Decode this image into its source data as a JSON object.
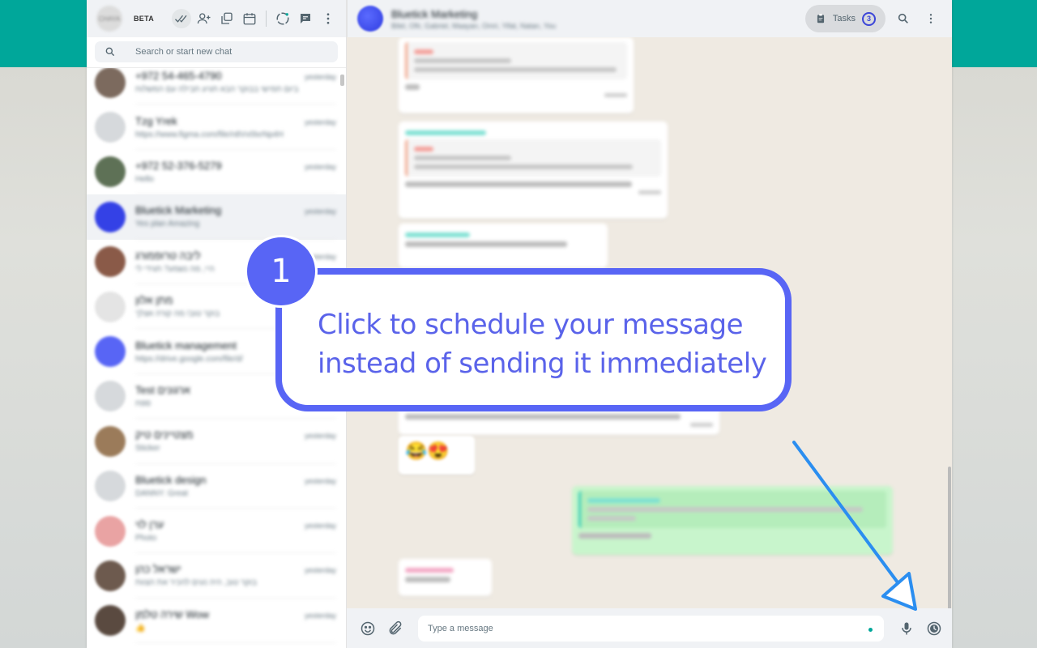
{
  "sidebar": {
    "avatar_text": "CHAYA",
    "beta_label": "BETA",
    "search_placeholder": "Search or start new chat",
    "chats": [
      {
        "name": "+972 54-465-4790",
        "time": "yesterday",
        "preview": "ביום חמישי בבוקר הבא תגיע חבילה עם המשלוח",
        "avatar": "#7c6a5e"
      },
      {
        "name": "Tzg Yrek",
        "time": "yesterday",
        "preview": "https://www.figma.com/file/n8Vv0lxrNp4H",
        "avatar": "#d6d9dc"
      },
      {
        "name": "+972 52-376-5279",
        "time": "yesterday",
        "preview": "Hello",
        "avatar": "#5e7156"
      },
      {
        "name": "Bluetick Marketing",
        "time": "yesterday",
        "preview": "Yes plan Amazing",
        "avatar": "#3441e6"
      },
      {
        "name": "ליבה טרופמורג",
        "time": "yesterday",
        "preview": "היי, מה נשמע? תגידי לי",
        "avatar": "#8a5a48"
      },
      {
        "name": "מתן אלון",
        "time": "yesterday",
        "preview": "בוקר טוב! מה קורה אצלך",
        "avatar": "#e4e4e4"
      },
      {
        "name": "Bluetick management",
        "time": "yesterday",
        "preview": "https://drive.google.com/file/d/",
        "avatar": "#5865f5"
      },
      {
        "name": "Test ארגונים",
        "time": "yesterday",
        "preview": "ספח",
        "avatar": "#d6d9dc"
      },
      {
        "name": "מצטיינים טיק",
        "time": "yesterday",
        "preview": "Sticker",
        "avatar": "#9b7b5a"
      },
      {
        "name": "Bluetick design",
        "time": "yesterday",
        "preview": "DANNY: Great",
        "avatar": "#d6d9dc"
      },
      {
        "name": "ערן לוי",
        "time": "yesterday",
        "preview": "Photo",
        "avatar": "#e9a3a3"
      },
      {
        "name": "ישראל כהן",
        "time": "yesterday",
        "preview": "בוקר טוב, היה נעים להכיר את הצוות",
        "avatar": "#6d5a4e"
      },
      {
        "name": "שירה טלמן Wow",
        "time": "yesterday",
        "preview": "👍",
        "avatar": "#5a4a40"
      }
    ]
  },
  "conversation": {
    "title": "Bluetick Marketing",
    "subtitle": "Bilel, Ofir, Gabriel, Maayan, Omri, Yifat, Natan, You",
    "tasks_label": "Tasks",
    "tasks_count": "3",
    "message_placeholder": "Type a message",
    "emoji_reaction": "😂😍"
  },
  "tutorial": {
    "step_number": "1",
    "line1": "Click to schedule your message",
    "line2": "instead of sending it immediately"
  },
  "colors": {
    "accent": "#00a79a",
    "callout": "#5865f5",
    "arrow": "#2b8ef0"
  }
}
